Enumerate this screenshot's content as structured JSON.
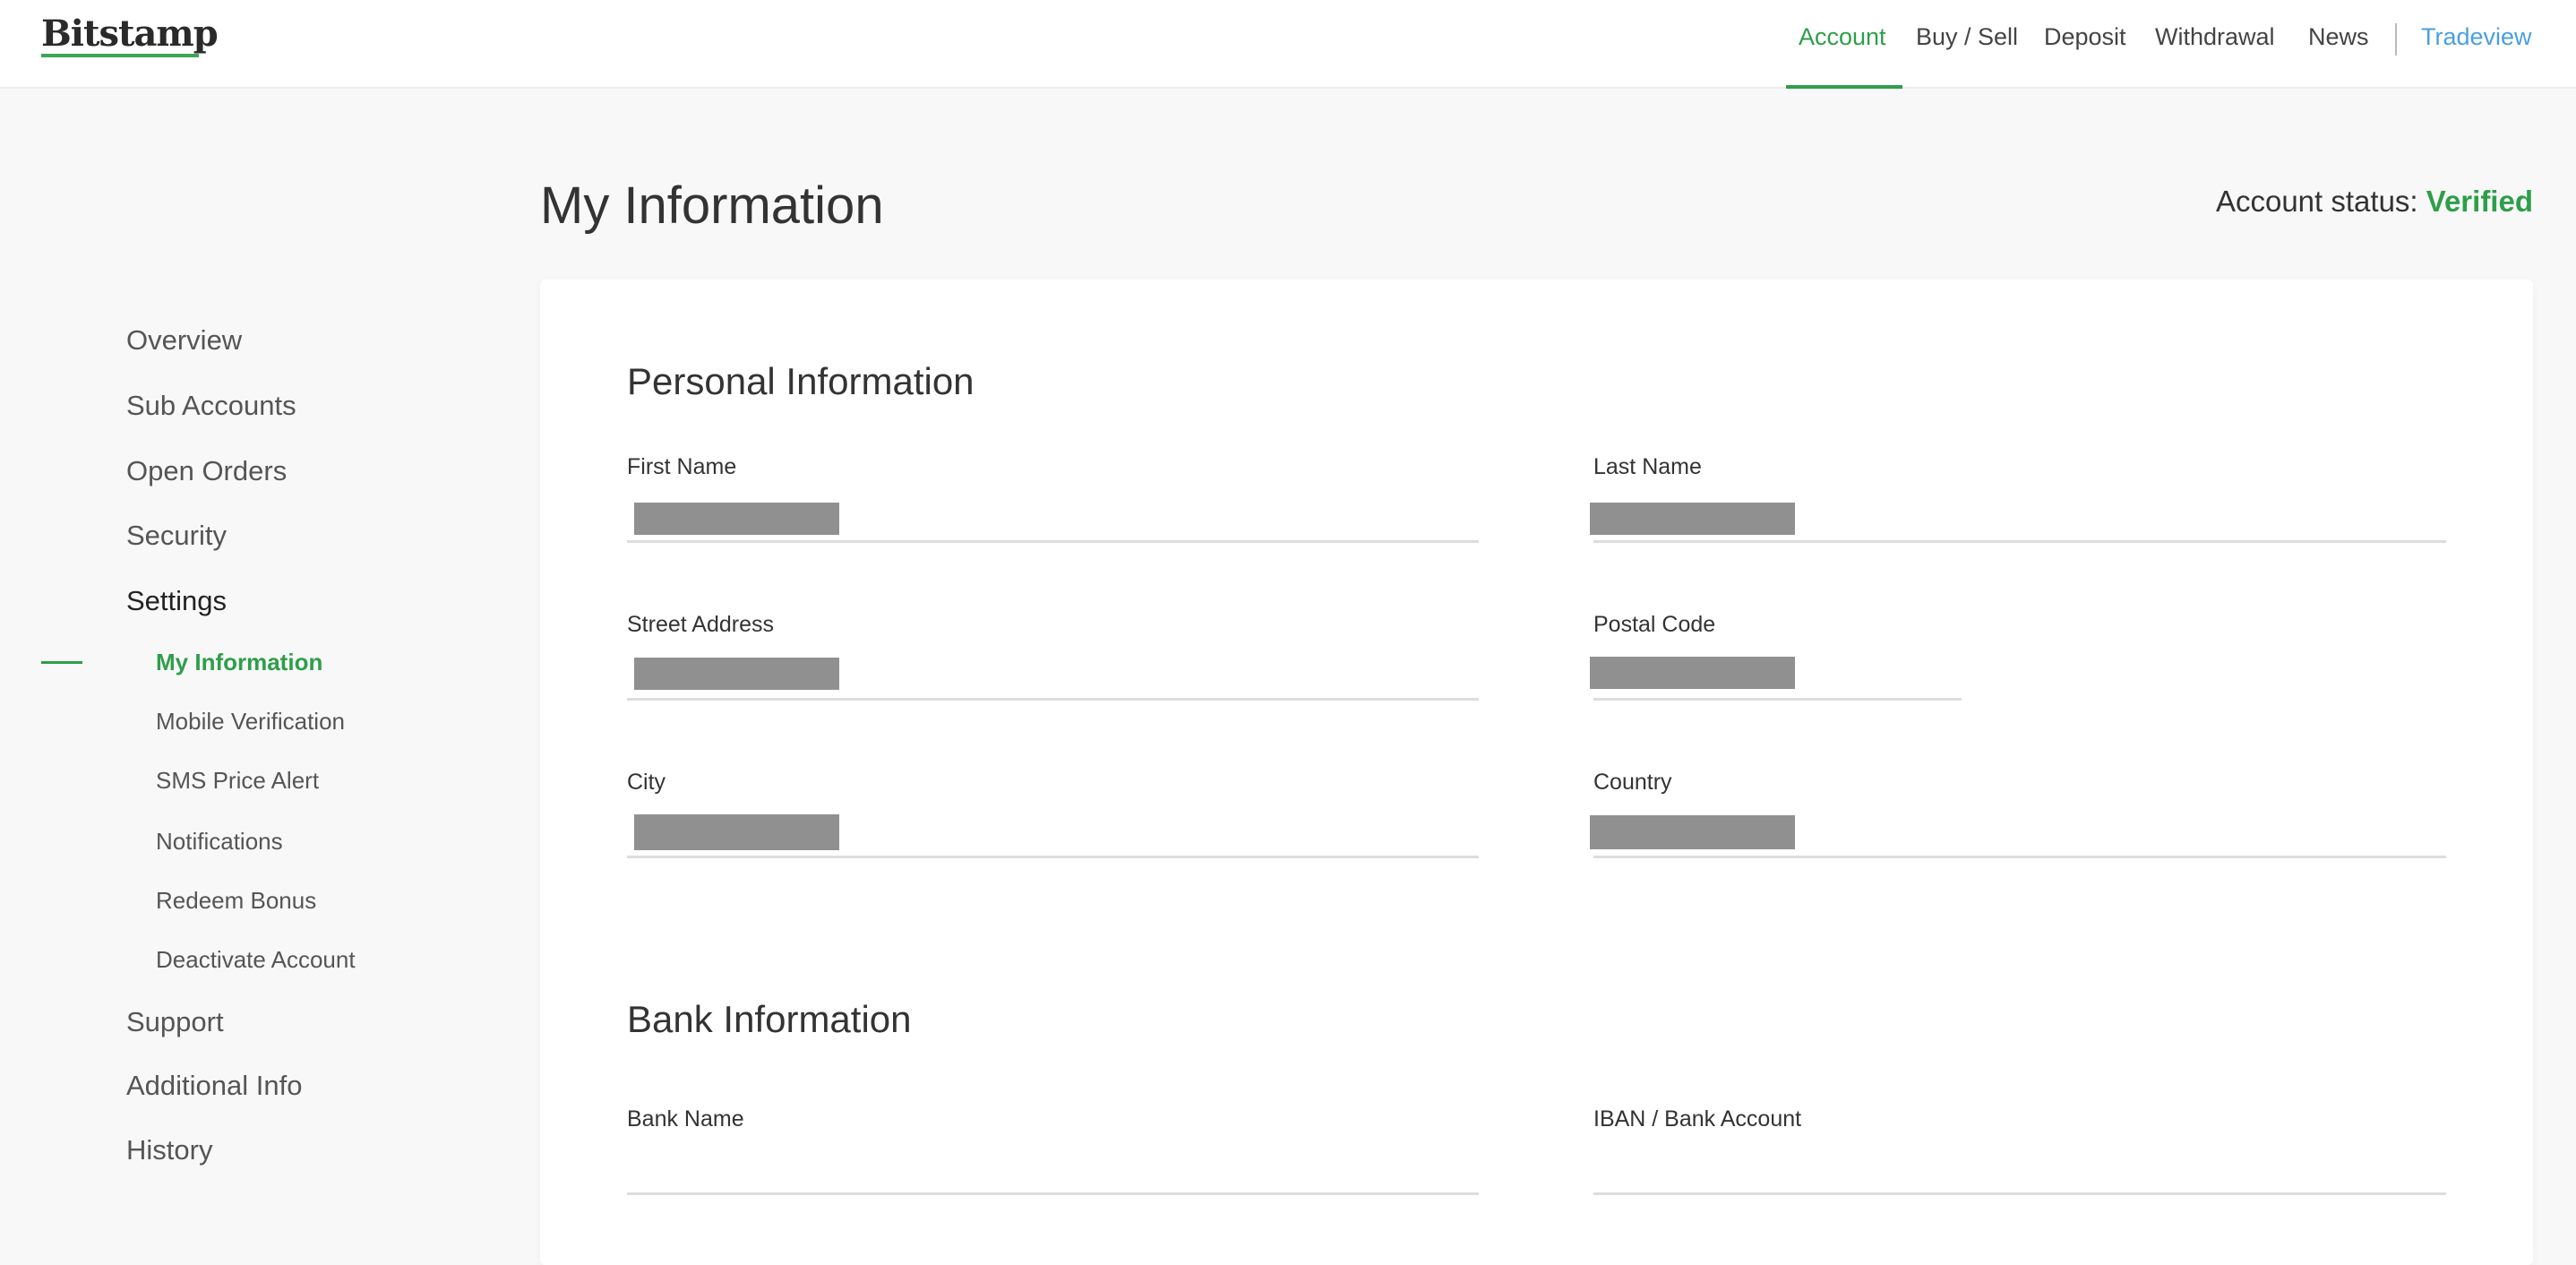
{
  "header": {
    "logo": "Bitstamp",
    "nav": [
      "Account",
      "Buy / Sell",
      "Deposit",
      "Withdrawal",
      "News"
    ],
    "tradeview": "Tradeview",
    "active": "Account"
  },
  "page": {
    "title": "My Information",
    "status_label": "Account status:",
    "status_value": "Verified"
  },
  "sidebar": {
    "items": [
      "Overview",
      "Sub Accounts",
      "Open Orders",
      "Security",
      "Settings"
    ],
    "settings_sub": [
      "My Information",
      "Mobile Verification",
      "SMS Price Alert",
      "Notifications",
      "Redeem Bonus",
      "Deactivate Account"
    ],
    "items_after": [
      "Support",
      "Additional Info",
      "History"
    ]
  },
  "personal": {
    "title": "Personal Information",
    "fields": [
      "First Name",
      "Last Name",
      "Street Address",
      "Postal Code",
      "City",
      "Country"
    ]
  },
  "bank": {
    "title": "Bank Information",
    "fields": [
      "Bank Name",
      "IBAN / Bank Account"
    ]
  },
  "colors": {
    "accent": "#2e9e4a",
    "link": "#4a9fe0",
    "redaction": "#909090"
  }
}
